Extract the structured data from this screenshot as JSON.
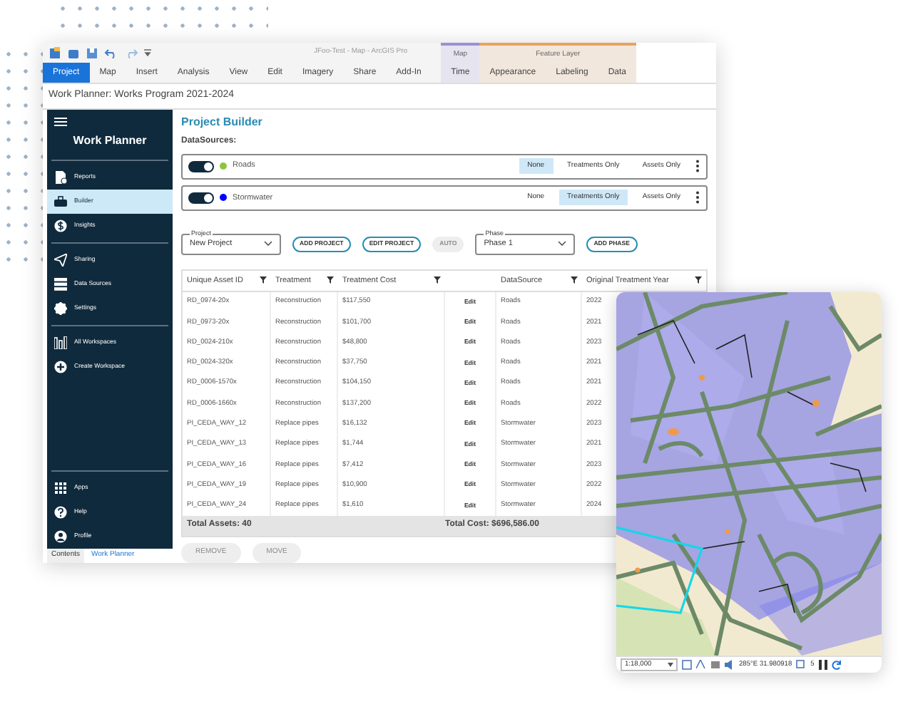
{
  "window": {
    "title": "JFoo-Test - Map - ArcGIS Pro"
  },
  "ribbon": {
    "tabs": [
      {
        "label": "Project",
        "selected": true
      },
      {
        "label": "Map",
        "selected": false
      },
      {
        "label": "Insert",
        "selected": false
      },
      {
        "label": "Analysis",
        "selected": false
      },
      {
        "label": "View",
        "selected": false
      },
      {
        "label": "Edit",
        "selected": false
      },
      {
        "label": "Imagery",
        "selected": false
      },
      {
        "label": "Share",
        "selected": false
      },
      {
        "label": "Add-In",
        "selected": false
      }
    ],
    "context_groups": [
      {
        "label": "Map",
        "color": "#9d8fd6",
        "tabs": [
          "Time"
        ]
      },
      {
        "label": "Feature Layer",
        "color": "#e9a25c",
        "tabs": [
          "Appearance",
          "Labeling",
          "Data"
        ]
      }
    ]
  },
  "pane": {
    "title": "Work Planner: Works Program 2021-2024"
  },
  "sidebar": {
    "title": "Work Planner",
    "sections": [
      [
        {
          "label": "Reports",
          "selected": false
        },
        {
          "label": "Builder",
          "selected": true
        },
        {
          "label": "Insights",
          "selected": false
        }
      ],
      [
        {
          "label": "Sharing",
          "selected": false
        },
        {
          "label": "Data Sources",
          "selected": false
        },
        {
          "label": "Settings",
          "selected": false
        }
      ],
      [
        {
          "label": "All Workspaces",
          "selected": false
        },
        {
          "label": "Create Workspace",
          "selected": false
        }
      ]
    ],
    "bottom": [
      {
        "label": "Apps",
        "selected": false
      },
      {
        "label": "Help",
        "selected": false
      },
      {
        "label": "Profile",
        "selected": false
      }
    ]
  },
  "bottom_tabs": [
    {
      "label": "Contents",
      "selected": false
    },
    {
      "label": "Work Planner",
      "selected": true
    }
  ],
  "builder": {
    "title": "Project Builder",
    "datasources_label": "DataSources:",
    "datasources": [
      {
        "name": "Roads",
        "on": true,
        "color": "#8cc63f",
        "options": [
          {
            "label": "None",
            "selected": true
          },
          {
            "label": "Treatments Only",
            "selected": false
          },
          {
            "label": "Assets Only",
            "selected": false
          }
        ]
      },
      {
        "name": "Stormwater",
        "on": true,
        "color": "#0000ff",
        "options": [
          {
            "label": "None",
            "selected": false
          },
          {
            "label": "Treatments Only",
            "selected": true
          },
          {
            "label": "Assets Only",
            "selected": false
          }
        ]
      }
    ],
    "toolbar": [
      {
        "kind": "select",
        "legend": "Project",
        "value": "New Project"
      },
      {
        "kind": "button",
        "label": "ADD PROJECT",
        "disabled": false
      },
      {
        "kind": "button",
        "label": "EDIT PROJECT",
        "disabled": false
      },
      {
        "kind": "button",
        "label": "AUTO",
        "disabled": true
      },
      {
        "kind": "select",
        "legend": "Phase",
        "value": "Phase 1"
      },
      {
        "kind": "button",
        "label": "ADD PHASE",
        "disabled": false
      }
    ],
    "table": {
      "columns": [
        {
          "kind": "text",
          "label": "Unique Asset ID"
        },
        {
          "kind": "text",
          "label": "Treatment"
        },
        {
          "kind": "text",
          "label": "Treatment Cost"
        },
        {
          "kind": "action"
        },
        {
          "kind": "text",
          "label": "DataSource"
        },
        {
          "kind": "text",
          "label": "Original Treatment Year"
        }
      ],
      "rows": [
        [
          "RD_0974-20x",
          "Reconstruction",
          "$117,550",
          "Edit",
          "Roads",
          "2022"
        ],
        [
          "RD_0973-20x",
          "Reconstruction",
          "$101,700",
          "Edit",
          "Roads",
          "2021"
        ],
        [
          "RD_0024-210x",
          "Reconstruction",
          "$48,800",
          "Edit",
          "Roads",
          "2023"
        ],
        [
          "RD_0024-320x",
          "Reconstruction",
          "$37,750",
          "Edit",
          "Roads",
          "2021"
        ],
        [
          "RD_0006-1570x",
          "Reconstruction",
          "$104,150",
          "Edit",
          "Roads",
          "2021"
        ],
        [
          "RD_0006-1660x",
          "Reconstruction",
          "$137,200",
          "Edit",
          "Roads",
          "2022"
        ],
        [
          "PI_CEDA_WAY_12",
          "Replace pipes",
          "$16,132",
          "Edit",
          "Stormwater",
          "2023"
        ],
        [
          "PI_CEDA_WAY_13",
          "Replace pipes",
          "$1,744",
          "Edit",
          "Stormwater",
          "2021"
        ],
        [
          "PI_CEDA_WAY_16",
          "Replace pipes",
          "$7,412",
          "Edit",
          "Stormwater",
          "2023"
        ],
        [
          "PI_CEDA_WAY_19",
          "Replace pipes",
          "$10,900",
          "Edit",
          "Stormwater",
          "2022"
        ],
        [
          "PI_CEDA_WAY_24",
          "Replace pipes",
          "$1,610",
          "Edit",
          "Stormwater",
          "2024"
        ]
      ],
      "total_assets": "Total Assets: 40",
      "total_cost": "Total Cost: $696,586.00"
    },
    "actions": [
      {
        "label": "REMOVE",
        "disabled": true
      },
      {
        "label": "MOVE",
        "disabled": true
      }
    ]
  },
  "map": {
    "scale": "1:18,000",
    "coordinates": "285°E 31.980918",
    "count": "5"
  }
}
